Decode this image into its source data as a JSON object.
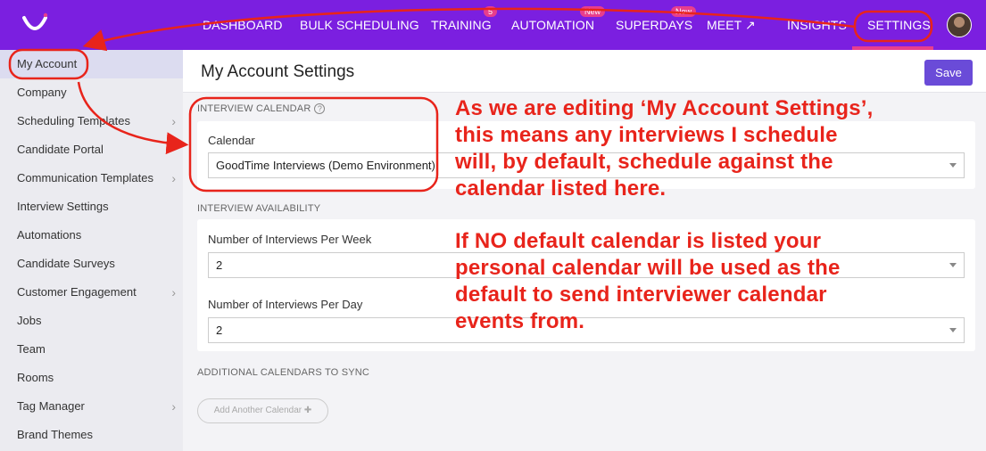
{
  "nav": {
    "items": [
      {
        "label": "DASHBOARD"
      },
      {
        "label": "BULK SCHEDULING"
      },
      {
        "label": "TRAINING",
        "badge": "5"
      },
      {
        "label": "AUTOMATION",
        "badge": "New"
      },
      {
        "label": "SUPERDAYS",
        "badge": "New"
      },
      {
        "label": "MEET ↗"
      },
      {
        "label": "INSIGHTS"
      },
      {
        "label": "SETTINGS"
      }
    ],
    "brand_color": "#7b1fe0",
    "accent_color": "#e83e8c"
  },
  "sidebar": {
    "items": [
      {
        "label": "My Account",
        "active": true
      },
      {
        "label": "Company"
      },
      {
        "label": "Scheduling Templates",
        "chevron": true
      },
      {
        "label": "Candidate Portal"
      },
      {
        "label": "Communication Templates",
        "chevron": true
      },
      {
        "label": "Interview Settings"
      },
      {
        "label": "Automations"
      },
      {
        "label": "Candidate Surveys"
      },
      {
        "label": "Customer Engagement",
        "chevron": true
      },
      {
        "label": "Jobs"
      },
      {
        "label": "Team"
      },
      {
        "label": "Rooms"
      },
      {
        "label": "Tag Manager",
        "chevron": true
      },
      {
        "label": "Brand Themes"
      }
    ]
  },
  "main": {
    "title": "My Account Settings",
    "save_label": "Save",
    "interview_calendar": {
      "section": "INTERVIEW CALENDAR",
      "field_label": "Calendar",
      "value": "GoodTime Interviews (Demo Environment)"
    },
    "availability": {
      "section": "INTERVIEW AVAILABILITY",
      "per_week_label": "Number of Interviews Per Week",
      "per_week_value": "2",
      "per_day_label": "Number of Interviews Per Day",
      "per_day_value": "2"
    },
    "additional": {
      "section": "ADDITIONAL CALENDARS TO SYNC",
      "add_label": "Add Another Calendar ✚"
    }
  },
  "annotations": {
    "text1": [
      "As we are editing ‘My Account Settings’,",
      "this means any interviews I schedule",
      "will, by default, schedule against the",
      "calendar listed here."
    ],
    "text2": [
      "If NO default calendar is listed your",
      "personal calendar will be used as the",
      "default to send interviewer calendar",
      "events from."
    ],
    "color": "#e8241b"
  }
}
